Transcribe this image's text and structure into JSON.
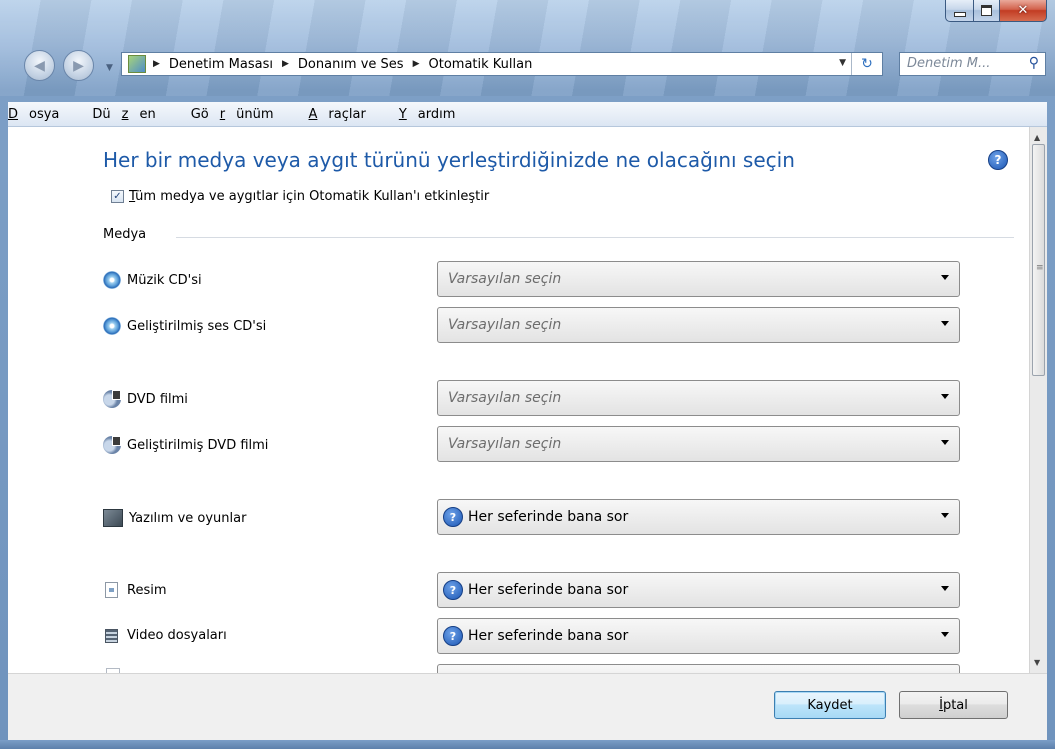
{
  "window": {
    "caption_buttons": {
      "minimize": "minimize-icon",
      "maximize": "maximize-icon",
      "close": "close-icon"
    }
  },
  "nav": {
    "back_icon": "back-arrow-icon",
    "forward_icon": "forward-arrow-icon",
    "breadcrumb": [
      "Denetim Masası",
      "Donanım ve Ses",
      "Otomatik Kullan"
    ],
    "search_placeholder": "Denetim M...",
    "accent": "#1e5aa8"
  },
  "menu": {
    "items": [
      {
        "label": "Dosya",
        "access": "D",
        "rest": "osya"
      },
      {
        "label": "Düzen",
        "pre": "Dü",
        "access": "z",
        "rest": "en"
      },
      {
        "label": "Görünüm",
        "pre": "Gö",
        "access": "r",
        "rest": "ünüm"
      },
      {
        "label": "Araçlar",
        "access": "A",
        "rest": "raçlar"
      },
      {
        "label": "Yardım",
        "access": "Y",
        "rest": "ardım"
      }
    ]
  },
  "main": {
    "title": "Her bir medya veya aygıt türünü yerleştirdiğinizde ne olacağını seçin",
    "autoplay_checkbox": {
      "checked": true,
      "access": "T",
      "label_rest": "üm medya ve aygıtlar için Otomatik Kullan'ı etkinleştir"
    },
    "group_label": "Medya",
    "rows": [
      {
        "label": "Müzik CD'si",
        "icon": "cd-icon",
        "value": "Varsayılan seçin",
        "placeholder": true
      },
      {
        "label": "Geliştirilmiş ses CD'si",
        "icon": "cd-icon",
        "value": "Varsayılan seçin",
        "placeholder": true
      },
      {
        "label": "DVD filmi",
        "icon": "dvd-icon",
        "value": "Varsayılan seçin",
        "placeholder": true
      },
      {
        "label": "Geliştirilmiş DVD filmi",
        "icon": "dvd-icon",
        "value": "Varsayılan seçin",
        "placeholder": true
      },
      {
        "label": "Yazılım ve oyunlar",
        "icon": "software-games-icon",
        "value": "Her seferinde bana sor",
        "placeholder": false
      },
      {
        "label": "Resim",
        "icon": "picture-icon",
        "value": "Her seferinde bana sor",
        "placeholder": false
      },
      {
        "label": "Video dosyaları",
        "icon": "video-icon",
        "value": "Her seferinde bana sor",
        "placeholder": false
      }
    ]
  },
  "footer": {
    "save_label": "Kaydet",
    "cancel_access": "İ",
    "cancel_rest": "ptal"
  }
}
